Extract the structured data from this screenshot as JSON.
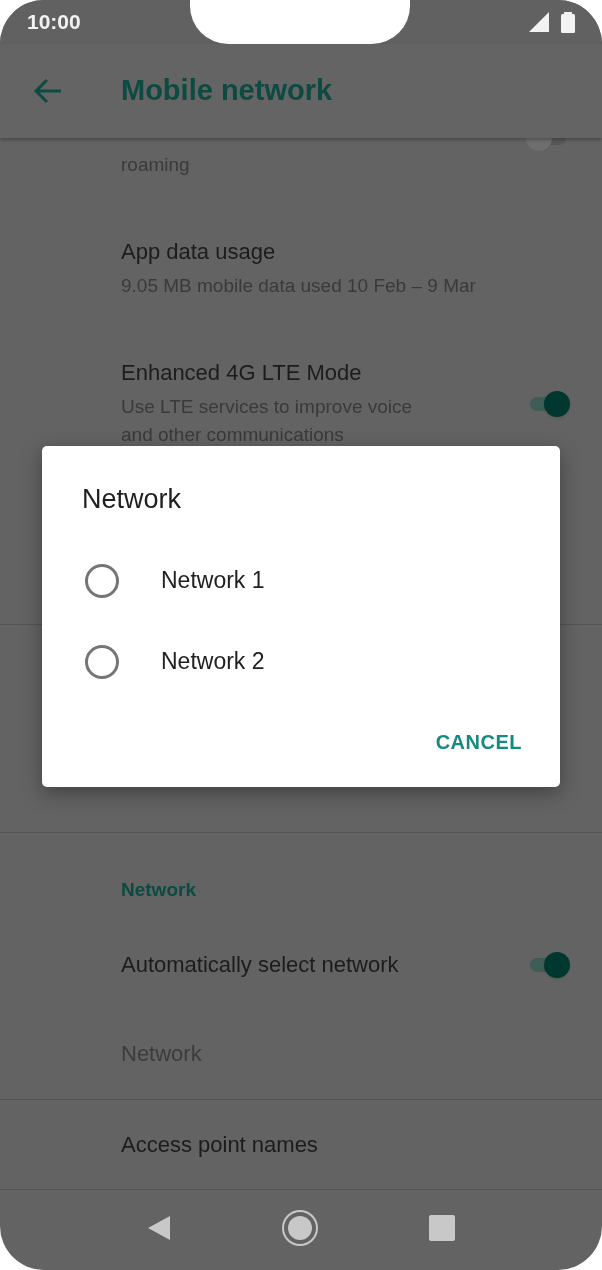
{
  "status_bar": {
    "time": "10:00"
  },
  "app_bar": {
    "title": "Mobile network"
  },
  "settings": [
    {
      "kind": "switch",
      "subtitle": "roaming",
      "on": false
    },
    {
      "kind": "text",
      "title": "App data usage",
      "subtitle": "9.05 MB mobile data used 10 Feb – 9 Mar"
    },
    {
      "kind": "switch",
      "title": "Enhanced 4G LTE Mode",
      "subtitle": "Use LTE services to improve voice and other communications",
      "on": true
    }
  ],
  "section": {
    "header": "Network",
    "items": [
      {
        "kind": "switch",
        "title": "Automatically select network",
        "on": true,
        "disabled": false
      },
      {
        "kind": "text",
        "title": "Network",
        "disabled": true
      },
      {
        "kind": "text",
        "title": "Access point names",
        "disabled": false
      }
    ]
  },
  "dialog": {
    "title": "Network",
    "options": [
      {
        "label": "Network 1",
        "selected": false
      },
      {
        "label": "Network 2",
        "selected": false
      }
    ],
    "buttons": [
      "CANCEL"
    ]
  }
}
